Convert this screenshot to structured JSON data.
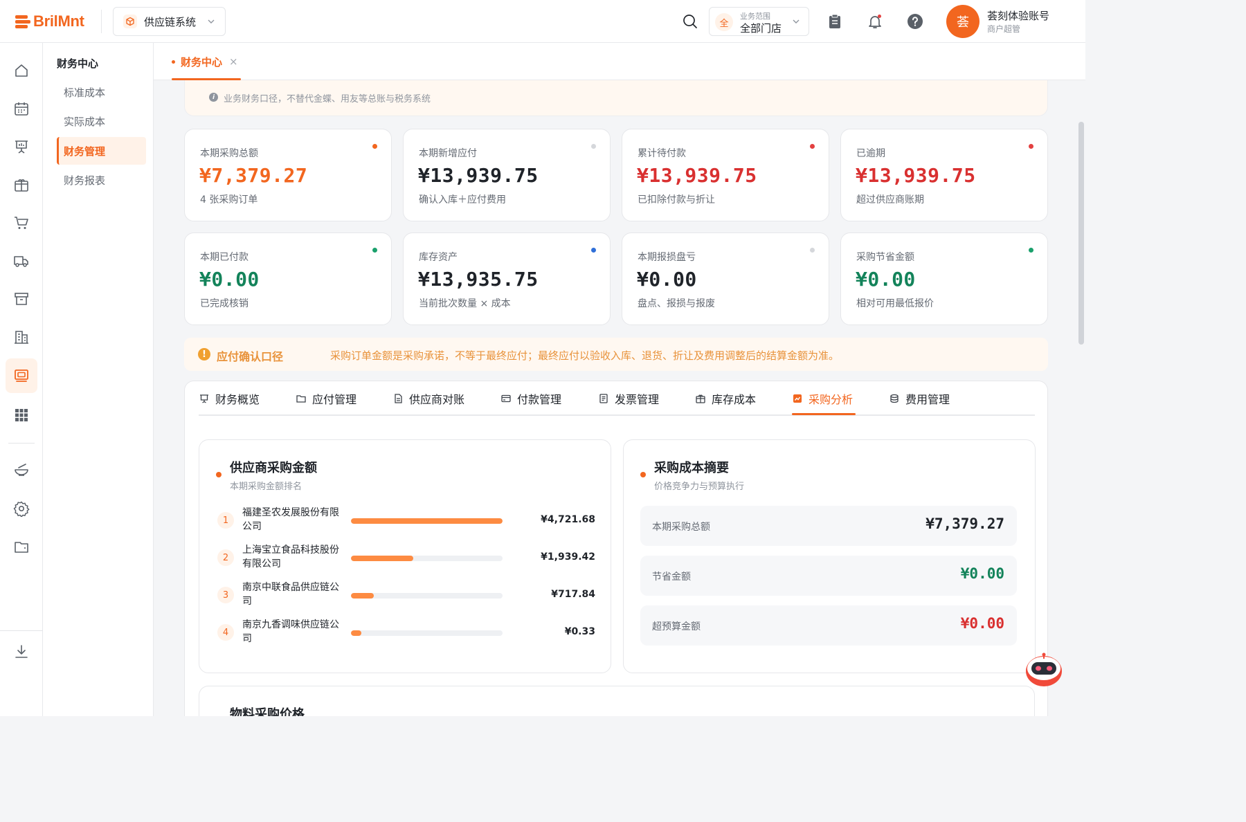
{
  "app": {
    "logo": "BrilMnt",
    "system": "供应链系统"
  },
  "scope": {
    "label": "业务范围",
    "value": "全部门店",
    "badge": "全"
  },
  "user": {
    "avatar": "荟",
    "name": "荟刻体验账号",
    "role": "商户超管"
  },
  "rail": {
    "icons": [
      "home-icon",
      "calendar-icon",
      "presentation-icon",
      "package-icon",
      "cart-icon",
      "truck-icon",
      "archive-icon",
      "building-icon",
      "finance-icon",
      "grid-icon",
      "bowl-icon",
      "gear-icon",
      "folder-icon",
      "download-icon"
    ],
    "active": "finance-icon"
  },
  "subnav": {
    "title": "财务中心",
    "items": [
      {
        "label": "标准成本"
      },
      {
        "label": "实际成本"
      },
      {
        "label": "财务管理",
        "active": true
      },
      {
        "label": "财务报表"
      }
    ]
  },
  "page_tab": {
    "label": "财务中心",
    "close": "×"
  },
  "notice": "业务财务口径，不替代金蝶、用友等总账与税务系统",
  "stats": [
    {
      "label": "本期采购总额",
      "value": "¥7,379.27",
      "sub": "4 张采购订单",
      "value_color": "#f2661f",
      "dot": "#f2661f"
    },
    {
      "label": "本期新增应付",
      "value": "¥13,939.75",
      "sub": "确认入库＋应付费用",
      "value_color": "#1f2329",
      "dot": "#d5d7db"
    },
    {
      "label": "累计待付款",
      "value": "¥13,939.75",
      "sub": "已扣除付款与折让",
      "value_color": "#d93030",
      "dot": "#e34040"
    },
    {
      "label": "已逾期",
      "value": "¥13,939.75",
      "sub": "超过供应商账期",
      "value_color": "#d93030",
      "dot": "#e34040"
    },
    {
      "label": "本期已付款",
      "value": "¥0.00",
      "sub": "已完成核销",
      "value_color": "#13835a",
      "dot": "#1aa06c"
    },
    {
      "label": "库存资产",
      "value": "¥13,935.75",
      "sub": "当前批次数量 × 成本",
      "value_color": "#1f2329",
      "dot": "#2f6fd8"
    },
    {
      "label": "本期报损盘亏",
      "value": "¥0.00",
      "sub": "盘点、报损与报废",
      "value_color": "#1f2329",
      "dot": "#d5d7db"
    },
    {
      "label": "采购节省金额",
      "value": "¥0.00",
      "sub": "相对可用最低报价",
      "value_color": "#13835a",
      "dot": "#1aa06c"
    }
  ],
  "warning": {
    "title": "应付确认口径",
    "text": "采购订单金额是采购承诺，不等于最终应付；最终应付以验收入库、退货、折让及费用调整后的结算金额为准。"
  },
  "tabs": [
    {
      "label": "财务概览",
      "icon": "presentation-icon"
    },
    {
      "label": "应付管理",
      "icon": "folder-icon"
    },
    {
      "label": "供应商对账",
      "icon": "document-icon"
    },
    {
      "label": "付款管理",
      "icon": "card-icon"
    },
    {
      "label": "发票管理",
      "icon": "invoice-icon"
    },
    {
      "label": "库存成本",
      "icon": "package-icon"
    },
    {
      "label": "采购分析",
      "icon": "chart-icon",
      "active": true
    },
    {
      "label": "费用管理",
      "icon": "coins-icon"
    }
  ],
  "supplier_card": {
    "title": "供应商采购金额",
    "subtitle": "本期采购金额排名",
    "rows": [
      {
        "rank": "1",
        "name": "福建圣农发展股份有限公司",
        "value": "¥4,721.68",
        "share": 1.0
      },
      {
        "rank": "2",
        "name": "上海宝立食品科技股份有限公司",
        "value": "¥1,939.42",
        "share": 0.41
      },
      {
        "rank": "3",
        "name": "南京中联食品供应链公司",
        "value": "¥717.84",
        "share": 0.152
      },
      {
        "rank": "4",
        "name": "南京九香调味供应链公司",
        "value": "¥0.33",
        "share": 0.07
      }
    ]
  },
  "summary_card": {
    "title": "采购成本摘要",
    "subtitle": "价格竞争力与预算执行",
    "rows": [
      {
        "label": "本期采购总额",
        "value": "¥7,379.27",
        "color": "#1f2329"
      },
      {
        "label": "节省金额",
        "value": "¥0.00",
        "color": "#13835a"
      },
      {
        "label": "超预算金额",
        "value": "¥0.00",
        "color": "#d93030"
      }
    ]
  },
  "next_card": {
    "title": "物料采购价格"
  }
}
